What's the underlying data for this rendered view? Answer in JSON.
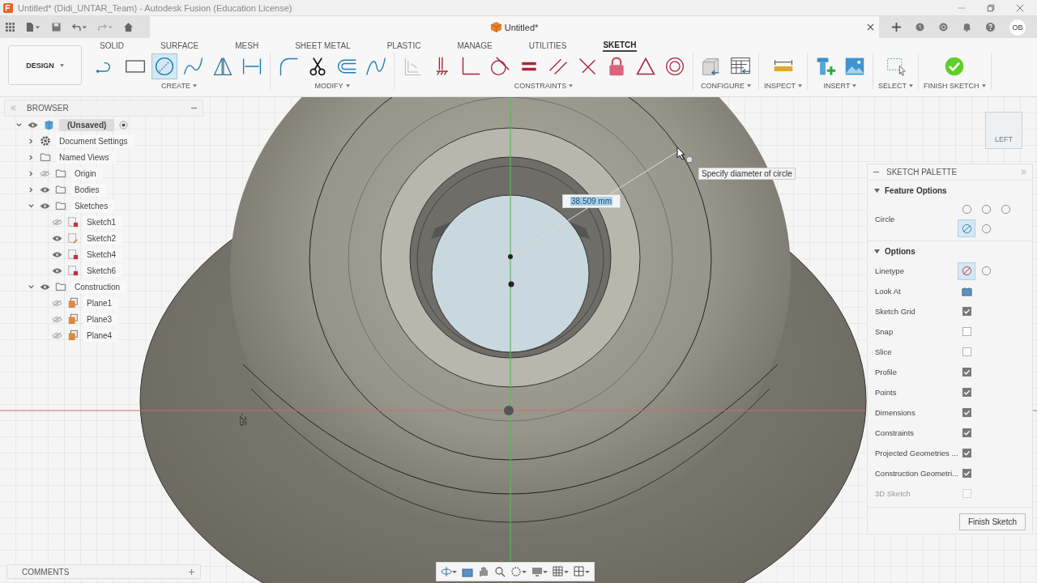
{
  "window": {
    "title": "Untitled* (Didi_UNTAR_Team) - Autodesk Fusion (Education License)"
  },
  "document_tab": {
    "title": "Untitled*"
  },
  "user_badge": "OB",
  "workspace_button": "DESIGN",
  "ribbon_tabs": [
    {
      "label": "SOLID",
      "selected": false
    },
    {
      "label": "SURFACE",
      "selected": false
    },
    {
      "label": "MESH",
      "selected": false
    },
    {
      "label": "SHEET METAL",
      "selected": false
    },
    {
      "label": "PLASTIC",
      "selected": false
    },
    {
      "label": "MANAGE",
      "selected": false
    },
    {
      "label": "UTILITIES",
      "selected": false
    },
    {
      "label": "SKETCH",
      "selected": true
    }
  ],
  "ribbon_groups": [
    {
      "label": "CREATE",
      "tools": [
        {
          "kind": "line",
          "selected": false
        },
        {
          "kind": "rectangle",
          "selected": false
        },
        {
          "kind": "circle",
          "selected": true
        },
        {
          "kind": "spline",
          "selected": false
        },
        {
          "kind": "mirror",
          "selected": false
        },
        {
          "kind": "dimension",
          "selected": false
        }
      ]
    },
    {
      "label": "MODIFY",
      "tools": [
        {
          "kind": "fillet",
          "selected": false
        },
        {
          "kind": "trim",
          "selected": false
        },
        {
          "kind": "offset",
          "selected": false
        },
        {
          "kind": "curve",
          "selected": false
        }
      ]
    },
    {
      "label": "CONSTRAINTS",
      "tools": [
        {
          "kind": "project",
          "selected": false
        },
        {
          "kind": "fix",
          "selected": false
        },
        {
          "kind": "perpendicular",
          "selected": false
        },
        {
          "kind": "tangent",
          "selected": false
        },
        {
          "kind": "equal",
          "selected": false
        },
        {
          "kind": "parallel",
          "selected": false
        },
        {
          "kind": "cross",
          "selected": false
        },
        {
          "kind": "lock",
          "selected": false
        },
        {
          "kind": "triangle",
          "selected": false
        },
        {
          "kind": "concentric",
          "selected": false
        }
      ]
    },
    {
      "label": "CONFIGURE",
      "tools": [
        {
          "kind": "cube",
          "selected": false
        },
        {
          "kind": "table",
          "selected": false
        }
      ]
    },
    {
      "label": "INSPECT",
      "tools": [
        {
          "kind": "ruler",
          "selected": false
        }
      ]
    },
    {
      "label": "INSERT",
      "tools": [
        {
          "kind": "bolt",
          "selected": false
        },
        {
          "kind": "image",
          "selected": false
        }
      ]
    },
    {
      "label": "SELECT",
      "tools": [
        {
          "kind": "select",
          "selected": false
        }
      ]
    },
    {
      "label": "FINISH SKETCH",
      "tools": [
        {
          "kind": "finish",
          "selected": false
        }
      ]
    }
  ],
  "browser": {
    "title": "BROWSER",
    "tree": [
      {
        "label": "(Unsaved)",
        "kind": "component",
        "expanded": true,
        "visible": true,
        "children": [
          {
            "label": "Document Settings",
            "kind": "gear",
            "expanded": false
          },
          {
            "label": "Named Views",
            "kind": "folder",
            "expanded": false
          },
          {
            "label": "Origin",
            "kind": "folder",
            "expanded": false,
            "visible": false
          },
          {
            "label": "Bodies",
            "kind": "folder",
            "expanded": false,
            "visible": true
          },
          {
            "label": "Sketches",
            "kind": "folder",
            "expanded": true,
            "visible": true,
            "children": [
              {
                "label": "Sketch1",
                "kind": "sketch-locked",
                "visible": false
              },
              {
                "label": "Sketch2",
                "kind": "sketch-edit",
                "visible": true
              },
              {
                "label": "Sketch4",
                "kind": "sketch-locked",
                "visible": true
              },
              {
                "label": "Sketch6",
                "kind": "sketch-locked",
                "visible": true
              }
            ]
          },
          {
            "label": "Construction",
            "kind": "folder",
            "expanded": true,
            "visible": true,
            "children": [
              {
                "label": "Plane1",
                "kind": "plane",
                "visible": false
              },
              {
                "label": "Plane3",
                "kind": "plane",
                "visible": false
              },
              {
                "label": "Plane4",
                "kind": "plane",
                "visible": false
              }
            ]
          }
        ]
      }
    ]
  },
  "viewport": {
    "dimension_value": "38.509 mm",
    "tooltip": "Specify diameter of circle",
    "axis_label": "-25",
    "viewcube_face": "LEFT"
  },
  "sketch_palette": {
    "title": "SKETCH PALETTE",
    "sections": [
      {
        "title": "Feature Options",
        "expanded": true,
        "rows": [
          {
            "kind": "icons",
            "label": "Circle",
            "options": [
              {
                "selected": false
              },
              {
                "selected": false
              },
              {
                "selected": false
              },
              {
                "selected": true
              },
              {
                "selected": false
              }
            ]
          }
        ]
      },
      {
        "title": "Options",
        "expanded": true,
        "rows": [
          {
            "kind": "icons",
            "label": "Linetype",
            "options": [
              {
                "selected": true
              },
              {
                "selected": false
              }
            ]
          },
          {
            "kind": "button",
            "label": "Look At"
          },
          {
            "kind": "checkbox",
            "label": "Sketch Grid",
            "checked": true,
            "disabled": false
          },
          {
            "kind": "checkbox",
            "label": "Snap",
            "checked": false,
            "disabled": false
          },
          {
            "kind": "checkbox",
            "label": "Slice",
            "checked": false,
            "disabled": false
          },
          {
            "kind": "checkbox",
            "label": "Profile",
            "checked": true,
            "disabled": false
          },
          {
            "kind": "checkbox",
            "label": "Points",
            "checked": true,
            "disabled": false
          },
          {
            "kind": "checkbox",
            "label": "Dimensions",
            "checked": true,
            "disabled": false
          },
          {
            "kind": "checkbox",
            "label": "Constraints",
            "checked": true,
            "disabled": false
          },
          {
            "kind": "checkbox",
            "label": "Projected Geometries ...",
            "checked": true,
            "disabled": false
          },
          {
            "kind": "checkbox",
            "label": "Construction Geometri...",
            "checked": true,
            "disabled": false
          },
          {
            "kind": "checkbox",
            "label": "3D Sketch",
            "checked": false,
            "disabled": true
          }
        ]
      }
    ],
    "finish_button": "Finish Sketch"
  },
  "comments": {
    "title": "COMMENTS"
  }
}
